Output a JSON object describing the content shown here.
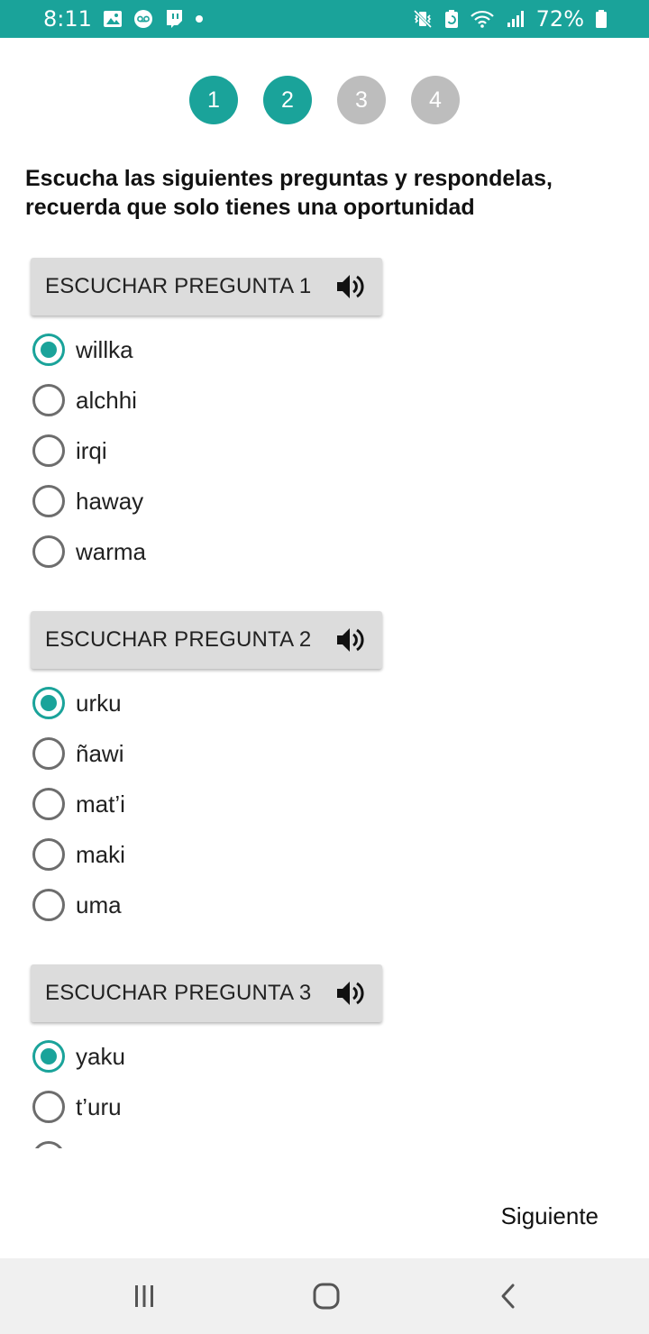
{
  "status_bar": {
    "time": "8:11",
    "battery": "72%",
    "icons_left": [
      "image-icon",
      "voicemail-icon",
      "twitch-icon",
      "dot-icon"
    ],
    "icons_right": [
      "mute-vibrate-icon",
      "battery-saver-icon",
      "wifi-icon",
      "signal-icon",
      "battery-icon"
    ],
    "color": "#1aa39a"
  },
  "stepper": {
    "steps": [
      {
        "label": "1",
        "active": true
      },
      {
        "label": "2",
        "active": true
      },
      {
        "label": "3",
        "active": false
      },
      {
        "label": "4",
        "active": false
      }
    ],
    "active_color": "#1aa39a",
    "inactive_color": "#bdbdbd"
  },
  "instruction": "Escucha las siguientes preguntas y respondelas, recuerda que solo tienes una oportunidad",
  "questions": [
    {
      "button_label": "ESCUCHAR PREGUNTA 1",
      "icon": "speaker-icon",
      "options": [
        {
          "label": "willka",
          "selected": true
        },
        {
          "label": "alchhi",
          "selected": false
        },
        {
          "label": "irqi",
          "selected": false
        },
        {
          "label": "haway",
          "selected": false
        },
        {
          "label": "warma",
          "selected": false
        }
      ]
    },
    {
      "button_label": "ESCUCHAR PREGUNTA 2",
      "icon": "speaker-icon",
      "options": [
        {
          "label": "urku",
          "selected": true
        },
        {
          "label": "ñawi",
          "selected": false
        },
        {
          "label": "mat’i",
          "selected": false
        },
        {
          "label": "maki",
          "selected": false
        },
        {
          "label": "uma",
          "selected": false
        }
      ]
    },
    {
      "button_label": "ESCUCHAR PREGUNTA 3",
      "icon": "speaker-icon",
      "options": [
        {
          "label": "yaku",
          "selected": true
        },
        {
          "label": "t’uru",
          "selected": false
        }
      ]
    }
  ],
  "next_label": "Siguiente",
  "nav_bar": {
    "buttons": [
      "recents-icon",
      "home-icon",
      "back-icon"
    ]
  }
}
